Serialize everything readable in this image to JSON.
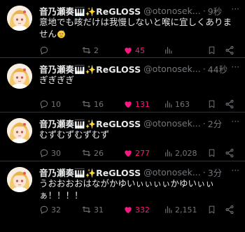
{
  "tweets": [
    {
      "name": "音乃瀬奏🎹✨ReGLOSS",
      "handle": "@otonosek...",
      "time": "9秒",
      "text": "意地でも咳だけは我慢しないと喉に宜しくありません",
      "emoji": "sweat-face",
      "reply_count": "",
      "retweet_count": "2",
      "like_count": "45",
      "view_count": ""
    },
    {
      "name": "音乃瀬奏🎹✨ReGLOSS",
      "handle": "@otonosek...",
      "time": "44秒",
      "text": "ぎぎぎぎ",
      "reply_count": "10",
      "retweet_count": "16",
      "like_count": "131",
      "view_count": "163"
    },
    {
      "name": "音乃瀬奏🎹✨ReGLOSS",
      "handle": "@otonosek...",
      "time": "2分",
      "text": "むずむずむずむず",
      "reply_count": "30",
      "retweet_count": "26",
      "like_count": "277",
      "view_count": "2,028"
    },
    {
      "name": "音乃瀬奏🎹✨ReGLOSS",
      "handle": "@otonosek...",
      "time": "3分",
      "text": "うおおおおはながかゆいぃぃぃぃかゆいぃぃぁ！！！！",
      "reply_count": "32",
      "retweet_count": "31",
      "like_count": "332",
      "view_count": "2,151"
    }
  ],
  "ui": {
    "separator": "·",
    "more_label": "···"
  },
  "colors": {
    "background": "#000000",
    "text": "#e7e9ea",
    "muted": "#71767b",
    "like": "#f91880",
    "divider": "#2f3336"
  },
  "icons": [
    "reply-icon",
    "retweet-icon",
    "liked-heart-icon",
    "views-icon",
    "bookmark-icon",
    "share-icon",
    "more-icon"
  ]
}
